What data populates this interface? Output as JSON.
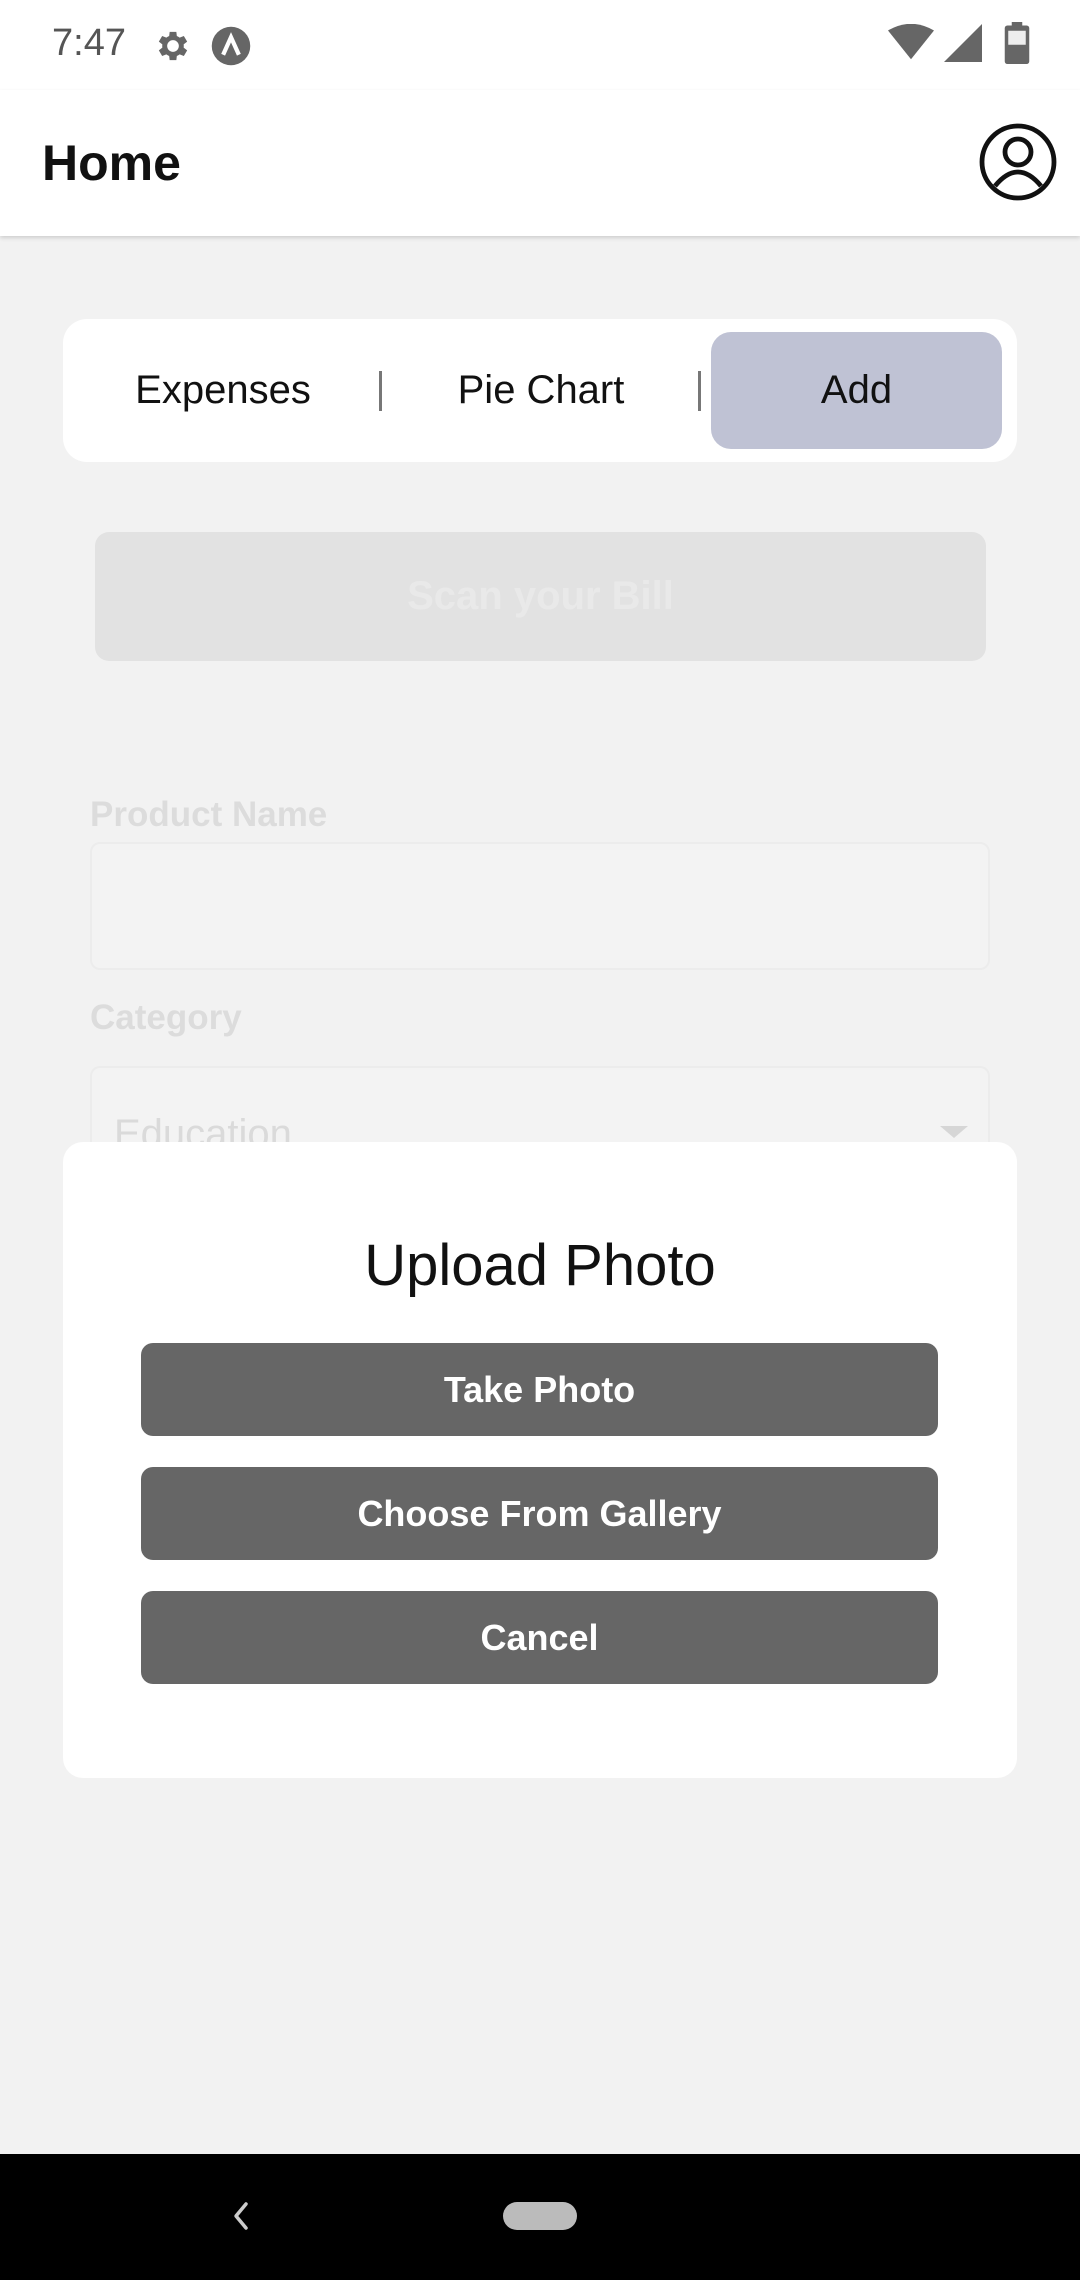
{
  "status_bar": {
    "time": "7:47",
    "icons": [
      "gear-icon",
      "app-notification-icon",
      "wifi-icon",
      "signal-icon",
      "battery-icon"
    ]
  },
  "app_bar": {
    "title": "Home",
    "profile_icon": "account-circle-icon"
  },
  "tabs": {
    "items": [
      {
        "label": "Expenses",
        "selected": false
      },
      {
        "label": "Pie Chart",
        "selected": false
      },
      {
        "label": "Add",
        "selected": true
      }
    ],
    "selected_color": "#bfc2d4"
  },
  "form": {
    "scan_button_label": "Scan your Bill",
    "product_name_label": "Product Name",
    "product_name_value": "",
    "category_label": "Category",
    "category_value": "Education"
  },
  "modal": {
    "title": "Upload Photo",
    "take_photo_label": "Take Photo",
    "gallery_label": "Choose From Gallery",
    "cancel_label": "Cancel",
    "button_color": "#666666"
  },
  "nav_bar": {
    "icons": [
      "back-icon",
      "home-pill-icon"
    ]
  }
}
